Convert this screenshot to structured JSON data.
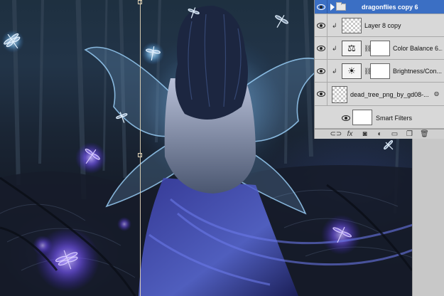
{
  "layers_panel": {
    "layers": [
      {
        "name": "dragonflies copy 6",
        "type": "group",
        "selected": true,
        "visible": true
      },
      {
        "name": "Layer 8 copy",
        "type": "pixel",
        "clipped": true,
        "visible": true
      },
      {
        "name": "Color Balance 6...",
        "type": "adjustment",
        "icon": "scales-icon",
        "clipped": true,
        "visible": true
      },
      {
        "name": "Brightness/Con...",
        "type": "adjustment",
        "icon": "sun-icon",
        "clipped": true,
        "visible": true
      },
      {
        "name": "dead_tree_png_by_gd08-...",
        "type": "smart-object",
        "visible": true
      },
      {
        "name": "Smart Filters",
        "type": "smart-filters",
        "visible": true
      }
    ],
    "footer_buttons": [
      {
        "name": "link-layers",
        "glyph": "⊂⊃"
      },
      {
        "name": "layer-style",
        "glyph": "fx"
      },
      {
        "name": "add-mask",
        "glyph": "◙"
      },
      {
        "name": "adjustment-layer",
        "glyph": "◐"
      },
      {
        "name": "new-group",
        "glyph": "▭"
      },
      {
        "name": "new-layer",
        "glyph": "❐"
      },
      {
        "name": "delete-layer",
        "glyph": "🗑"
      }
    ]
  },
  "colors": {
    "selection_blue": "#3b6fc4",
    "panel_gray": "#d6d6d6",
    "guide": "#e6d7b9"
  }
}
